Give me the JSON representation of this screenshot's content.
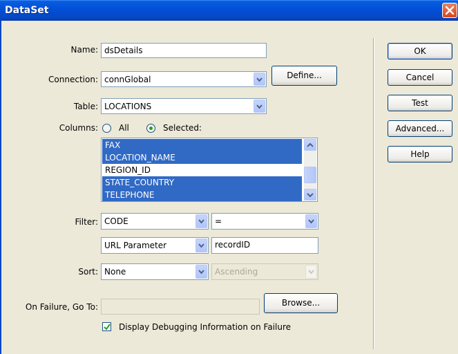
{
  "window": {
    "title": "DataSet"
  },
  "form": {
    "name_label": "Name:",
    "name_value": "dsDetails",
    "connection_label": "Connection:",
    "connection_value": "connGlobal",
    "define_button": "Define...",
    "table_label": "Table:",
    "table_value": "LOCATIONS",
    "columns_label": "Columns:",
    "columns_all_label": "All",
    "columns_selected_label": "Selected:",
    "columns_mode": "Selected",
    "column_items": [
      {
        "label": "FAX",
        "selected": true
      },
      {
        "label": "LOCATION_NAME",
        "selected": true
      },
      {
        "label": "REGION_ID",
        "selected": false
      },
      {
        "label": "STATE_COUNTRY",
        "selected": true
      },
      {
        "label": "TELEPHONE",
        "selected": true
      }
    ],
    "filter_label": "Filter:",
    "filter_column": "CODE",
    "filter_operator": "=",
    "filter_source": "URL Parameter",
    "filter_value": "recordID",
    "sort_label": "Sort:",
    "sort_column": "None",
    "sort_order": "Ascending",
    "on_failure_label": "On Failure, Go To:",
    "on_failure_value": "",
    "browse_button": "Browse...",
    "debug_checkbox_label": "Display Debugging Information on Failure",
    "debug_checked": true
  },
  "buttons": {
    "ok": "OK",
    "cancel": "Cancel",
    "test": "Test",
    "advanced": "Advanced...",
    "help": "Help"
  },
  "colors": {
    "titlebar": "#0A5FE0",
    "selection": "#316AC5",
    "dialog_bg": "#ECE9D8",
    "radio_dot": "#21A121"
  }
}
